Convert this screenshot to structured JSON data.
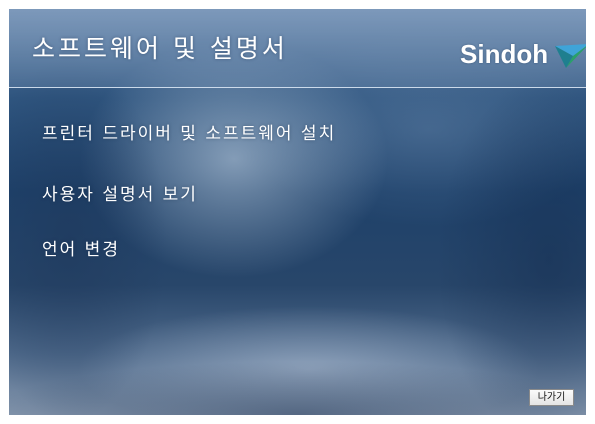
{
  "header": {
    "title": "소프트웨어 및 설명서",
    "brand_name": "Sindoh",
    "brand_icon": "sindoh-logo-arrow-icon"
  },
  "menu": {
    "items": [
      {
        "label": "프린터 드라이버 및 소프트웨어 설치"
      },
      {
        "label": "사용자 설명서 보기"
      },
      {
        "label": "언어 변경"
      }
    ]
  },
  "footer": {
    "exit_label": "나가기"
  },
  "colors": {
    "background_dark": "#1e416a",
    "background_light": "#8496ad",
    "text": "#ffffff",
    "logo_green": "#2aa06a",
    "logo_blue": "#3fa4d8"
  }
}
